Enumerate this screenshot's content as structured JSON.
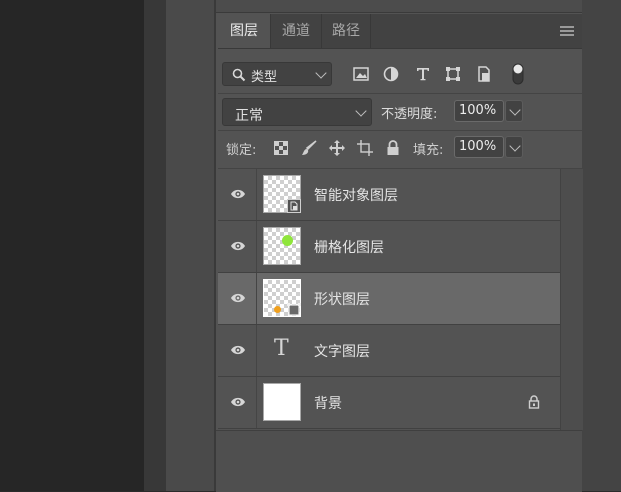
{
  "tabs": [
    {
      "label": "图层",
      "active": true
    },
    {
      "label": "通道",
      "active": false
    },
    {
      "label": "路径",
      "active": false
    }
  ],
  "filter": {
    "kind_label": "类型",
    "icons": [
      "image-filter-icon",
      "adjustment-filter-icon",
      "type-filter-icon",
      "shape-filter-icon",
      "smart-object-filter-icon",
      "filter-toggle-icon"
    ]
  },
  "blend": {
    "mode": "正常",
    "opacity_label": "不透明度:",
    "opacity_value": "100%"
  },
  "lock": {
    "label": "锁定:",
    "fill_label": "填充:",
    "fill_value": "100%",
    "icons": [
      "lock-transparent-pixels-icon",
      "lock-image-pixels-icon",
      "lock-position-icon",
      "lock-artboard-icon",
      "lock-all-icon"
    ]
  },
  "layers": [
    {
      "name": "智能对象图层",
      "type": "smart-object",
      "selected": false
    },
    {
      "name": "栅格化图层",
      "type": "raster",
      "selected": false,
      "dot_color": "#8fe53b"
    },
    {
      "name": "形状图层",
      "type": "shape",
      "selected": true,
      "dot_color": "#f0a01e"
    },
    {
      "name": "文字图层",
      "type": "text",
      "selected": false,
      "glyph": "T"
    },
    {
      "name": "背景",
      "type": "background",
      "selected": false,
      "locked": true
    }
  ],
  "colors": {
    "panel": "#535353",
    "selected_row": "#696969",
    "tab_bar": "#424242"
  }
}
